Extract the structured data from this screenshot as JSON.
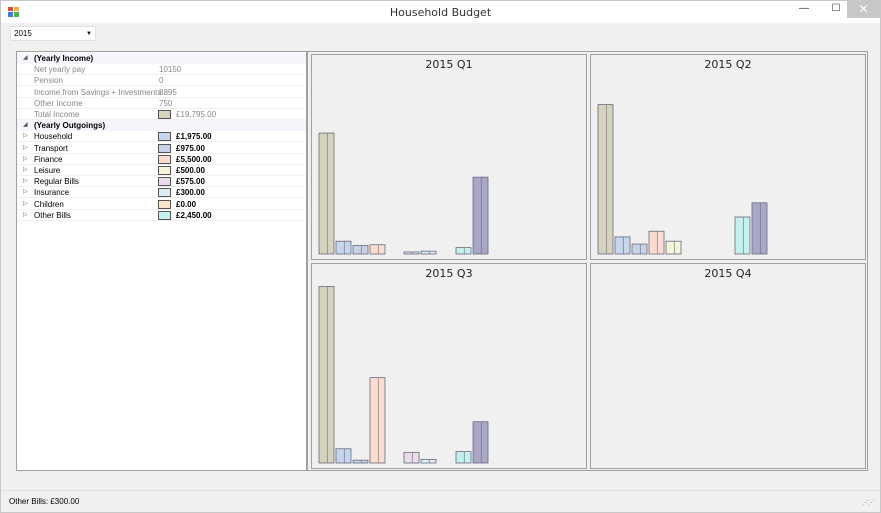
{
  "window": {
    "title": "Household Budget",
    "min_glyph": "—",
    "max_glyph": "☐",
    "close_glyph": "✕"
  },
  "year_selector": {
    "value": "2015"
  },
  "tree": {
    "income": {
      "label": "(Yearly Income)",
      "items": [
        {
          "name": "Net yearly pay",
          "value": "10150"
        },
        {
          "name": "Pension",
          "value": "0"
        },
        {
          "name": "Income from Savings + Investments",
          "value": "8895"
        },
        {
          "name": "Other Income",
          "value": "750"
        },
        {
          "name": "Total Income",
          "value": "£19,795.00",
          "color": "#d5d3bd"
        }
      ]
    },
    "outgoings": {
      "label": "(Yearly Outgoings)",
      "items": [
        {
          "name": "Household",
          "value": "£1,975.00",
          "color": "#c6d6ec"
        },
        {
          "name": "Transport",
          "value": "£975.00",
          "color": "#c8d2e6"
        },
        {
          "name": "Finance",
          "value": "£5,500.00",
          "color": "#fcdcd0"
        },
        {
          "name": "Leisure",
          "value": "£500.00",
          "color": "#f5f3d8"
        },
        {
          "name": "Regular Bills",
          "value": "£575.00",
          "color": "#eadcec"
        },
        {
          "name": "Insurance",
          "value": "£300.00",
          "color": "#dcecf2"
        },
        {
          "name": "Children",
          "value": "£0.00",
          "color": "#fce4cc"
        },
        {
          "name": "Other Bills",
          "value": "£2,450.00",
          "color": "#c4f0ee"
        }
      ]
    }
  },
  "colors": {
    "income": "#d5d3bd",
    "household": "#c6d6ec",
    "transport": "#c8d2e6",
    "finance": "#fcdcd0",
    "leisure": "#f5f3d8",
    "regular_bills": "#eadcec",
    "insurance": "#dcecf2",
    "other_bills": "#c4f0ee",
    "outgoings_total": "#a8a8c6"
  },
  "chart_data": [
    {
      "type": "bar",
      "title": "2015 Q1",
      "series": [
        {
          "key": "income",
          "value": 8500
        },
        {
          "key": "household",
          "value": 900
        },
        {
          "key": "transport",
          "value": 600
        },
        {
          "key": "finance",
          "value": 650
        },
        {
          "key": "leisure",
          "value": 0
        },
        {
          "key": "regular_bills",
          "value": 100
        },
        {
          "key": "insurance",
          "value": 200
        },
        {
          "key": "other_bills",
          "value": 450
        },
        {
          "key": "outgoings_total",
          "value": 5400
        }
      ]
    },
    {
      "type": "bar",
      "title": "2015 Q2",
      "series": [
        {
          "key": "income",
          "value": 10500
        },
        {
          "key": "household",
          "value": 1200
        },
        {
          "key": "transport",
          "value": 700
        },
        {
          "key": "finance",
          "value": 1600
        },
        {
          "key": "leisure",
          "value": 900
        },
        {
          "key": "regular_bills",
          "value": 0
        },
        {
          "key": "insurance",
          "value": 0
        },
        {
          "key": "other_bills",
          "value": 2600
        },
        {
          "key": "outgoings_total",
          "value": 3600
        }
      ]
    },
    {
      "type": "bar",
      "title": "2015 Q3",
      "series": [
        {
          "key": "income",
          "value": 12400
        },
        {
          "key": "household",
          "value": 1000
        },
        {
          "key": "transport",
          "value": 200
        },
        {
          "key": "finance",
          "value": 6000
        },
        {
          "key": "leisure",
          "value": 0
        },
        {
          "key": "regular_bills",
          "value": 750
        },
        {
          "key": "insurance",
          "value": 250
        },
        {
          "key": "other_bills",
          "value": 800
        },
        {
          "key": "outgoings_total",
          "value": 2900
        }
      ]
    },
    {
      "type": "bar",
      "title": "2015 Q4",
      "series": []
    }
  ],
  "status": {
    "text": "Other Bills: £300.00"
  }
}
